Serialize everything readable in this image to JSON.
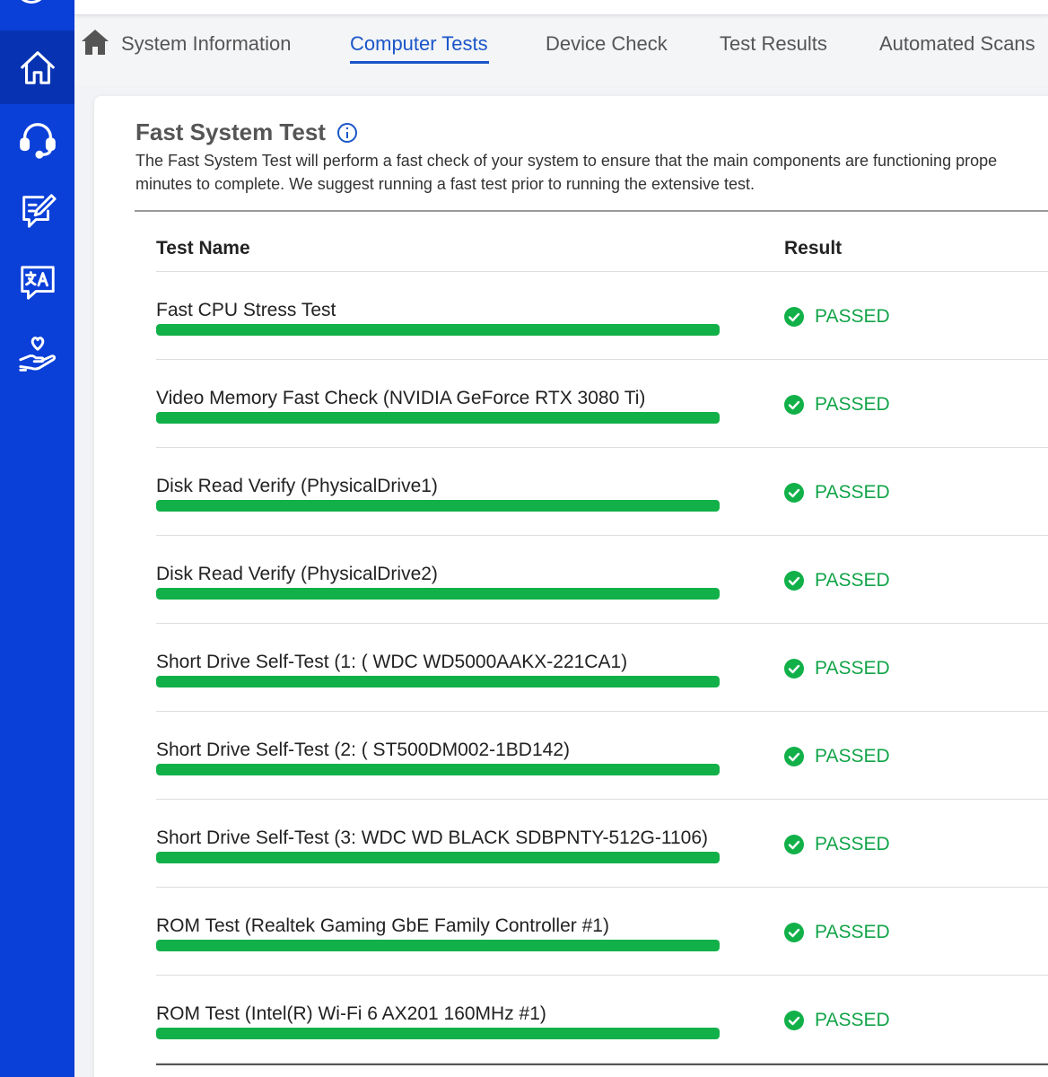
{
  "nav": {
    "items": [
      {
        "icon": "home-icon",
        "active": true
      },
      {
        "icon": "headset-icon",
        "active": false
      },
      {
        "icon": "feedback-icon",
        "active": false
      },
      {
        "icon": "translate-icon",
        "active": false
      },
      {
        "icon": "care-hand-icon",
        "active": false
      }
    ]
  },
  "tabs": [
    {
      "label": "System Information",
      "active": false
    },
    {
      "label": "Computer Tests",
      "active": true
    },
    {
      "label": "Device Check",
      "active": false
    },
    {
      "label": "Test Results",
      "active": false
    },
    {
      "label": "Automated Scans",
      "active": false
    }
  ],
  "section": {
    "title": "Fast System Test",
    "description_line1": "The Fast System Test will perform a fast check of your system to ensure that the main components are functioning prope",
    "description_line2": "minutes to complete. We suggest running a fast test prior to running the extensive test."
  },
  "table": {
    "col_test_name": "Test Name",
    "col_result": "Result",
    "rows": [
      {
        "name": "Fast CPU Stress Test",
        "progress": 1.0,
        "result": "PASSED"
      },
      {
        "name": "Video Memory Fast Check (NVIDIA GeForce RTX 3080 Ti)",
        "progress": 1.0,
        "result": "PASSED"
      },
      {
        "name": "Disk Read Verify (PhysicalDrive1)",
        "progress": 1.0,
        "result": "PASSED"
      },
      {
        "name": "Disk Read Verify (PhysicalDrive2)",
        "progress": 1.0,
        "result": "PASSED"
      },
      {
        "name": "Short Drive Self-Test (1: ( WDC WD5000AAKX-221CA1)",
        "progress": 1.0,
        "result": "PASSED"
      },
      {
        "name": "Short Drive Self-Test (2: ( ST500DM002-1BD142)",
        "progress": 1.0,
        "result": "PASSED"
      },
      {
        "name": "Short Drive Self-Test (3: WDC WD BLACK SDBPNTY-512G-1106)",
        "progress": 1.0,
        "result": "PASSED"
      },
      {
        "name": "ROM Test (Realtek Gaming GbE Family Controller #1)",
        "progress": 1.0,
        "result": "PASSED"
      },
      {
        "name": "ROM Test (Intel(R) Wi-Fi 6 AX201 160MHz #1)",
        "progress": 1.0,
        "result": "PASSED"
      }
    ]
  },
  "colors": {
    "sidebar": "#0a3fd8",
    "accent": "#1a56c8",
    "pass": "#12b049"
  }
}
